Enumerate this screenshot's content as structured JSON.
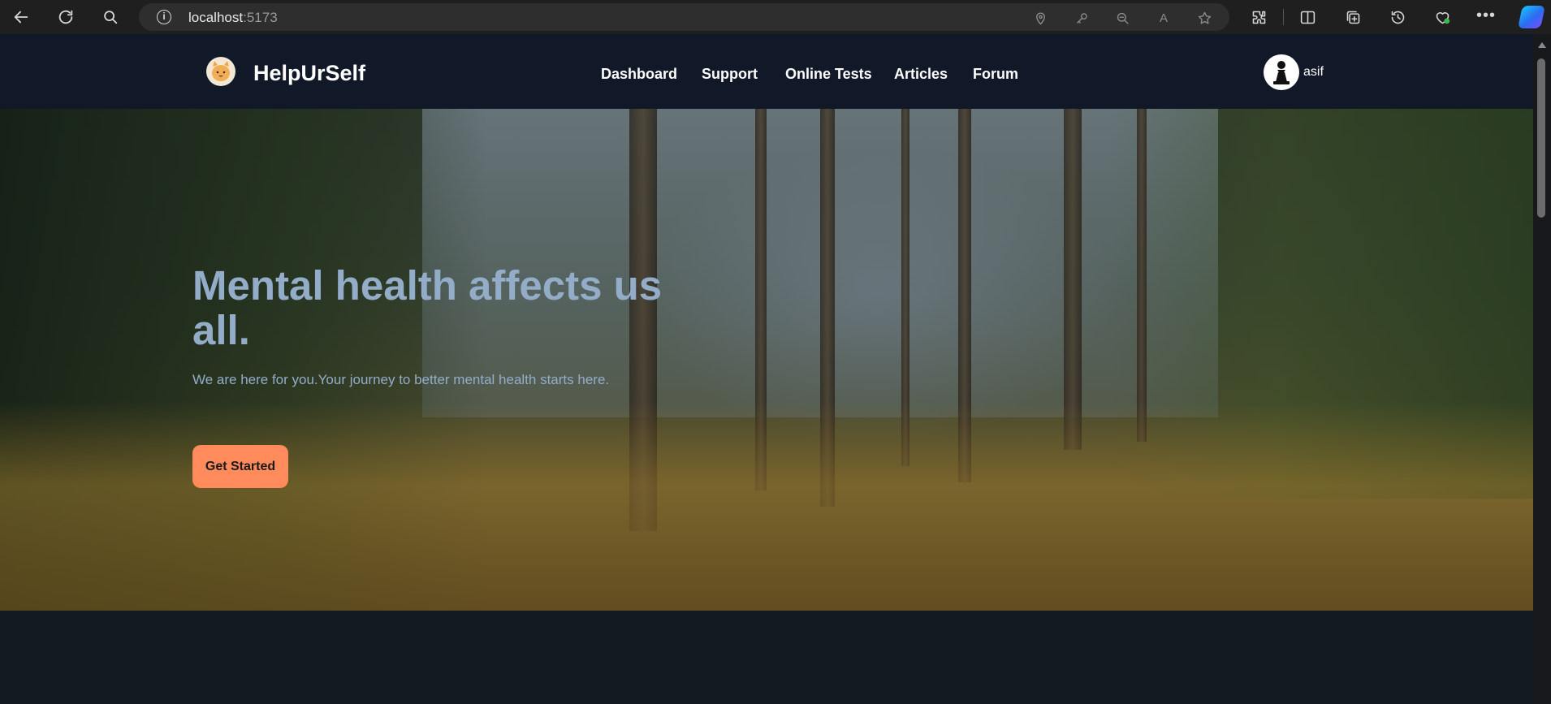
{
  "browser": {
    "url_host": "localhost",
    "url_port": ":5173",
    "read_aloud_icon": "A"
  },
  "navbar": {
    "brand": "HelpUrSelf",
    "links": [
      "Dashboard",
      "Support",
      "Online Tests",
      "Articles",
      "Forum"
    ],
    "user_name": "asif"
  },
  "hero": {
    "title": "Mental health affects us all.",
    "subtitle": "We are here for you.Your journey to better mental health starts here.",
    "cta_label": "Get Started"
  },
  "colors": {
    "nav_bg": "#111827",
    "page_bg": "#141a22",
    "hero_text": "#93adc9",
    "cta_bg": "#ff8a5c"
  }
}
